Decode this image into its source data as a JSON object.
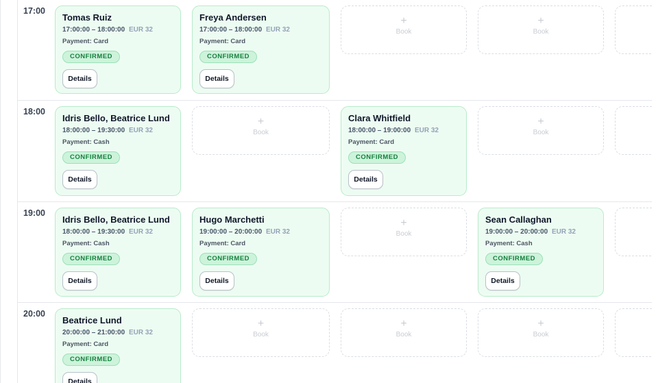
{
  "rows": [
    {
      "time": "17:00"
    },
    {
      "time": "18:00"
    },
    {
      "time": "19:00"
    },
    {
      "time": "20:00"
    }
  ],
  "bookings": {
    "r17_c1": {
      "name": "Tomas Ruiz",
      "time": "17:00:00 – 18:00:00",
      "price": "EUR 32",
      "payment": "Payment: Card",
      "status": "CONFIRMED",
      "action": "Details"
    },
    "r17_c2": {
      "name": "Freya Andersen",
      "time": "17:00:00 – 18:00:00",
      "price": "EUR 32",
      "payment": "Payment: Card",
      "status": "CONFIRMED",
      "action": "Details"
    },
    "r18_c1": {
      "name": "Idris Bello, Beatrice Lund",
      "time": "18:00:00 – 19:30:00",
      "price": "EUR 32",
      "payment": "Payment: Cash",
      "status": "CONFIRMED",
      "action": "Details"
    },
    "r18_c3": {
      "name": "Clara Whitfield",
      "time": "18:00:00 – 19:00:00",
      "price": "EUR 32",
      "payment": "Payment: Card",
      "status": "CONFIRMED",
      "action": "Details"
    },
    "r19_c1": {
      "name": "Idris Bello, Beatrice Lund",
      "time": "18:00:00 – 19:30:00",
      "price": "EUR 32",
      "payment": "Payment: Cash",
      "status": "CONFIRMED",
      "action": "Details"
    },
    "r19_c2": {
      "name": "Hugo Marchetti",
      "time": "19:00:00 – 20:00:00",
      "price": "EUR 32",
      "payment": "Payment: Card",
      "status": "CONFIRMED",
      "action": "Details"
    },
    "r19_c4": {
      "name": "Sean Callaghan",
      "time": "19:00:00 – 20:00:00",
      "price": "EUR 32",
      "payment": "Payment: Cash",
      "status": "CONFIRMED",
      "action": "Details"
    },
    "r20_c1": {
      "name": "Beatrice Lund",
      "time": "20:00:00 – 21:00:00",
      "price": "EUR 32",
      "payment": "Payment: Card",
      "status": "CONFIRMED",
      "action": "Details"
    }
  },
  "empty_slot": {
    "icon": "plus-icon",
    "plus_glyph": "+",
    "label": "Book"
  },
  "colors": {
    "confirmed_bg": "#edfcf2",
    "confirmed_border": "#b8ebcb",
    "confirmed_text": "#15803d",
    "empty_text": "#c8ccd2"
  }
}
